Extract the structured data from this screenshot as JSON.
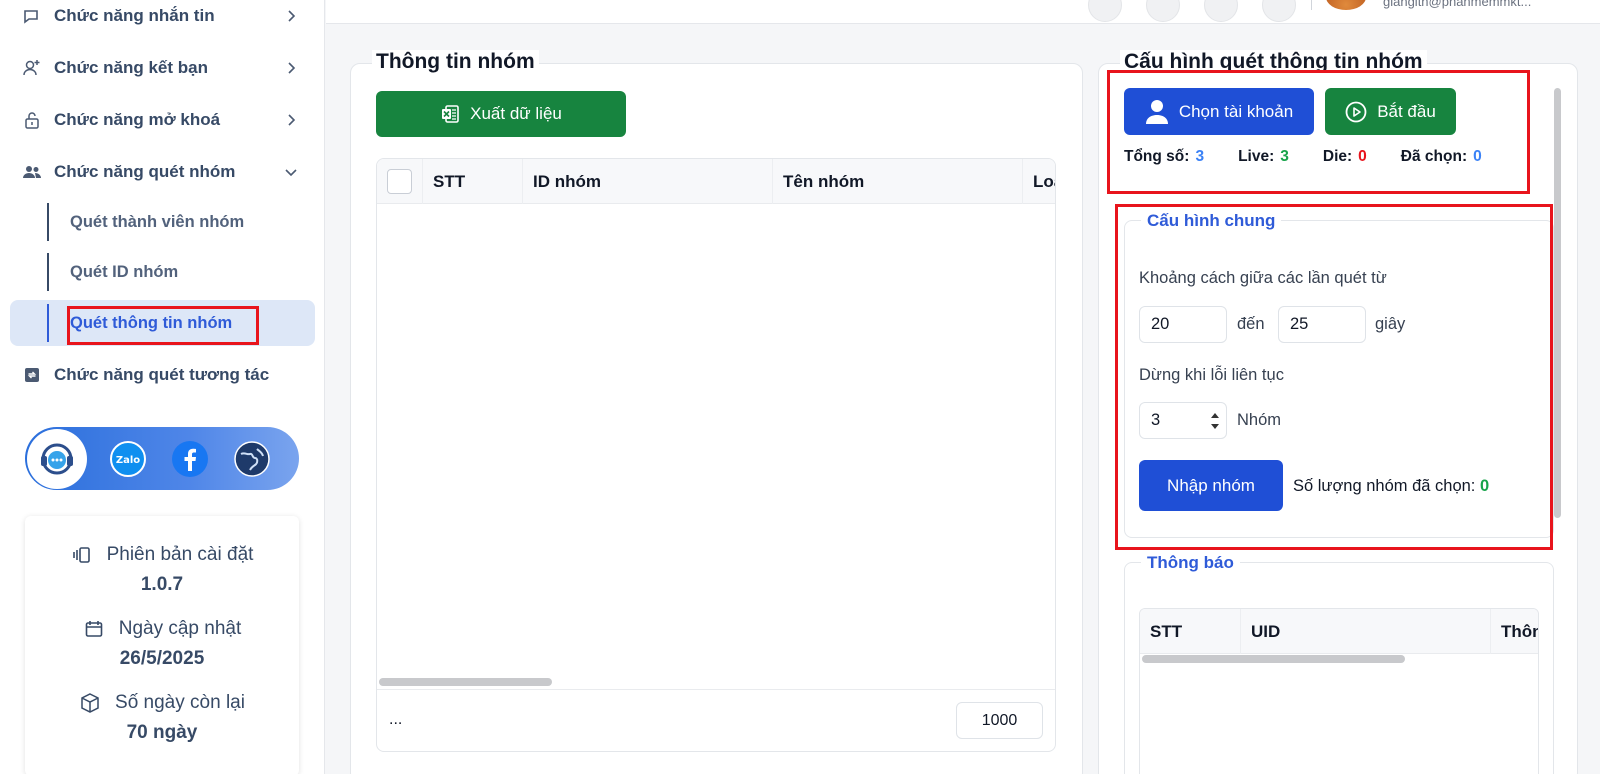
{
  "sidebar": {
    "items": [
      {
        "label": "Chức năng nhắn tin"
      },
      {
        "label": "Chức năng kết bạn"
      },
      {
        "label": "Chức năng mở khoá"
      },
      {
        "label": "Chức năng quét nhóm"
      },
      {
        "label": "Chức năng quét tương tác"
      }
    ],
    "sub_items": [
      {
        "label": "Quét thành viên nhóm"
      },
      {
        "label": "Quét ID nhóm"
      },
      {
        "label": "Quét thông tin nhóm"
      }
    ],
    "social": [
      "support-icon",
      "zalo-icon",
      "facebook-icon",
      "globe-icon"
    ],
    "info": {
      "version_label": "Phiên bản cài đặt",
      "version_value": "1.0.7",
      "update_label": "Ngày cập nhật",
      "update_value": "26/5/2025",
      "days_label": "Số ngày còn lại",
      "days_value": "70 ngày"
    }
  },
  "header": {
    "email": "giangith@phanmemmkt..."
  },
  "group_info": {
    "title": "Thông tin nhóm",
    "export_label": "Xuất dữ liệu",
    "columns": [
      "STT",
      "ID nhóm",
      "Tên nhóm",
      "Loại"
    ],
    "footer_text": "...",
    "page_size": "1000"
  },
  "config": {
    "title": "Cấu hình quét thông tin nhóm",
    "choose_account_label": "Chọn tài khoản",
    "start_label": "Bắt đầu",
    "stats": {
      "total_label": "Tổng số:",
      "total_value": "3",
      "live_label": "Live:",
      "live_value": "3",
      "die_label": "Die:",
      "die_value": "0",
      "selected_label": "Đã chọn:",
      "selected_value": "0"
    },
    "general": {
      "legend": "Cấu hình chung",
      "interval_label": "Khoảng cách giữa các lần quét từ",
      "from_value": "20",
      "to_label": "đến",
      "to_value": "25",
      "unit_label": "giây",
      "stop_label": "Dừng khi lỗi liên tục",
      "stop_value": "3",
      "stop_unit": "Nhóm",
      "import_label": "Nhập nhóm",
      "count_label": "Số lượng nhóm đã chọn:",
      "count_value": "0"
    },
    "notify": {
      "legend": "Thông báo",
      "columns": [
        "STT",
        "UID",
        "Thông"
      ]
    }
  },
  "colors": {
    "primary": "#1f4fd6",
    "success": "#17843f",
    "danger": "#e8141c",
    "accent_text": "#2f5bd8"
  }
}
